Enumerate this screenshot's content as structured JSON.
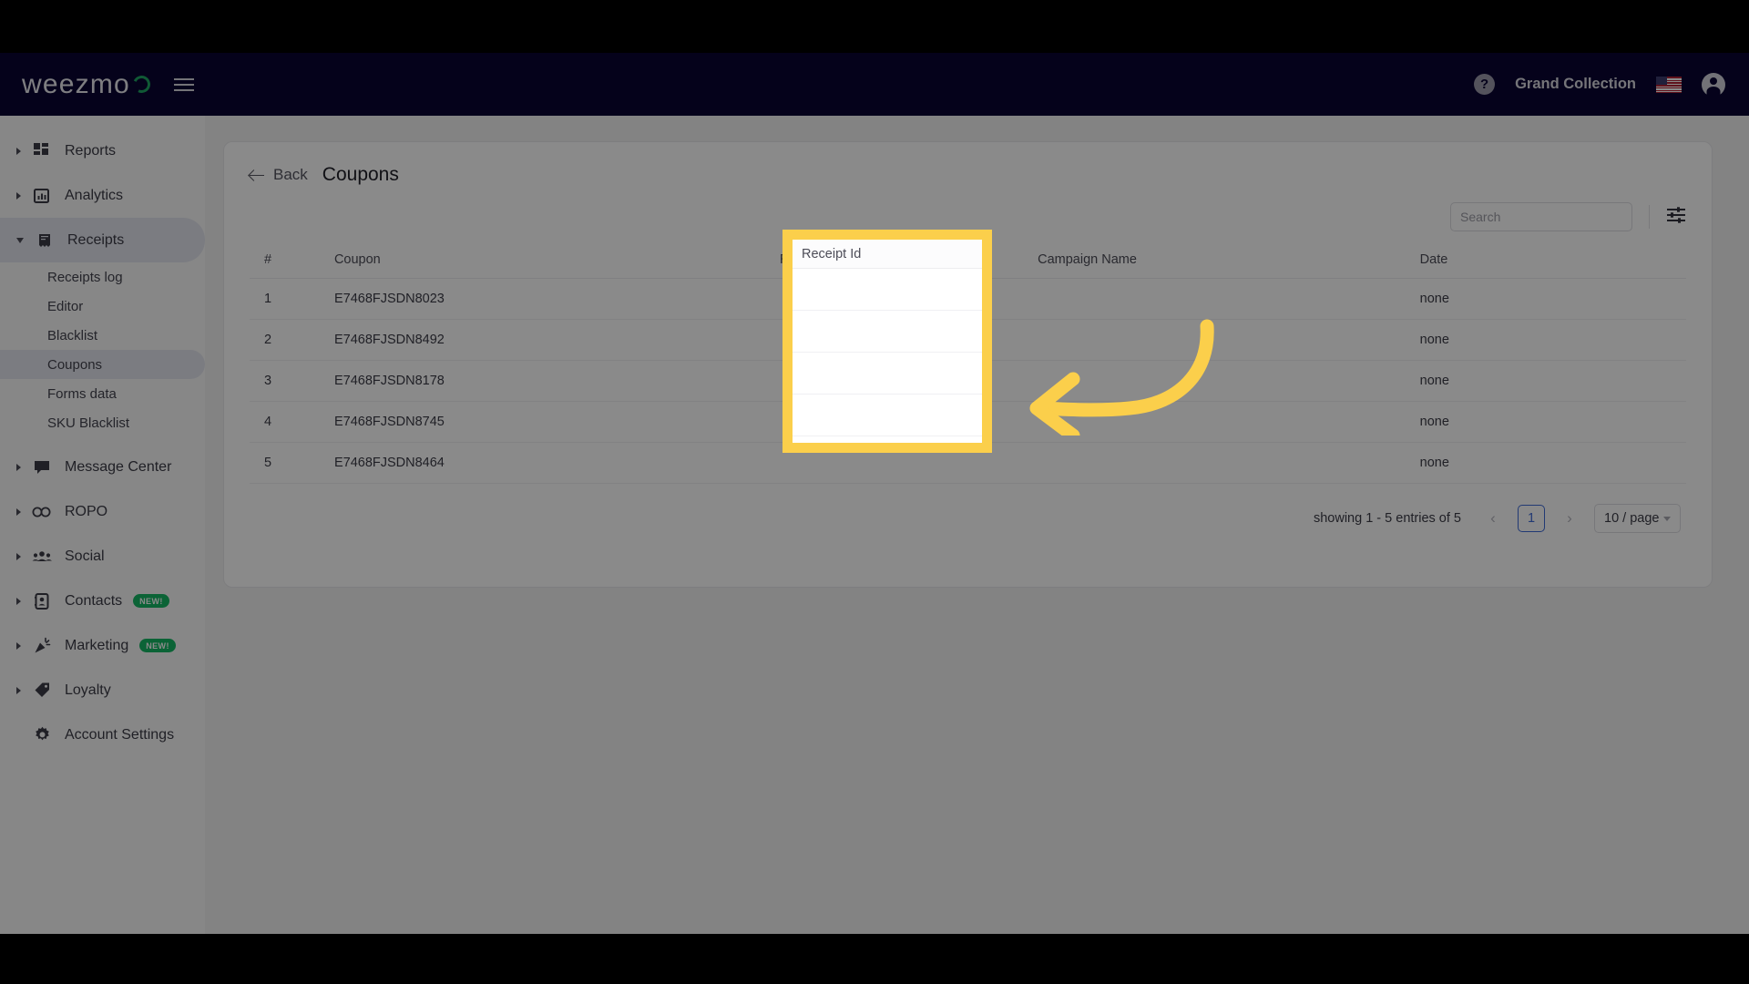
{
  "header": {
    "logo_text": "weezmo",
    "menu_icon": "hamburger-icon",
    "help_icon": "help-icon",
    "help_label": "?",
    "account_name": "Grand Collection",
    "language_flag": "us-flag",
    "avatar_icon": "account-avatar-icon"
  },
  "sidebar": {
    "items": [
      {
        "label": "Reports",
        "icon": "reports-icon",
        "expandable": true,
        "expanded": false,
        "active": false
      },
      {
        "label": "Analytics",
        "icon": "analytics-icon",
        "expandable": true,
        "expanded": false,
        "active": false
      },
      {
        "label": "Receipts",
        "icon": "receipts-icon",
        "expandable": true,
        "expanded": true,
        "active": true
      }
    ],
    "receipts_subitems": [
      {
        "label": "Receipts log",
        "active": false
      },
      {
        "label": "Editor",
        "active": false
      },
      {
        "label": "Blacklist",
        "active": false
      },
      {
        "label": "Coupons",
        "active": true
      },
      {
        "label": "Forms data",
        "active": false
      },
      {
        "label": "SKU Blacklist",
        "active": false
      }
    ],
    "items_lower": [
      {
        "label": "Message Center",
        "icon": "message-icon",
        "badge": "",
        "expandable": true
      },
      {
        "label": "ROPO",
        "icon": "ropo-icon",
        "badge": "",
        "expandable": true
      },
      {
        "label": "Social",
        "icon": "social-icon",
        "badge": "",
        "expandable": true
      },
      {
        "label": "Contacts",
        "icon": "contacts-icon",
        "badge": "NEW!",
        "expandable": true
      },
      {
        "label": "Marketing",
        "icon": "marketing-icon",
        "badge": "NEW!",
        "expandable": true
      },
      {
        "label": "Loyalty",
        "icon": "loyalty-icon",
        "badge": "",
        "expandable": true
      }
    ],
    "account_settings": {
      "label": "Account Settings",
      "icon": "gear-icon"
    }
  },
  "main": {
    "back_label": "Back",
    "page_title": "Coupons",
    "search": {
      "placeholder": "Search",
      "value": "",
      "icon": "search-icon"
    },
    "filter_icon": "filter-sliders-icon",
    "table": {
      "columns": [
        "#",
        "Coupon",
        "Receipt Id",
        "Campaign Name",
        "Date"
      ],
      "rows": [
        {
          "num": "1",
          "coupon": "E7468FJSDN8023",
          "receipt_id": "",
          "campaign_name": "",
          "date": "none"
        },
        {
          "num": "2",
          "coupon": "E7468FJSDN8492",
          "receipt_id": "",
          "campaign_name": "",
          "date": "none"
        },
        {
          "num": "3",
          "coupon": "E7468FJSDN8178",
          "receipt_id": "",
          "campaign_name": "",
          "date": "none"
        },
        {
          "num": "4",
          "coupon": "E7468FJSDN8745",
          "receipt_id": "",
          "campaign_name": "",
          "date": "none"
        },
        {
          "num": "5",
          "coupon": "E7468FJSDN8464",
          "receipt_id": "",
          "campaign_name": "",
          "date": "none"
        }
      ]
    },
    "pagination": {
      "showing_text": "showing 1 - 5 entries of 5",
      "prev_icon": "chevron-left-icon",
      "next_icon": "chevron-right-icon",
      "current_page": "1",
      "per_page": "10 / page"
    }
  },
  "annotation": {
    "highlight_column": "Receipt Id",
    "highlight_color": "#fbcf4b",
    "arrow_icon": "curved-arrow-left-icon",
    "arrow_color": "#fbcf4b"
  },
  "colors": {
    "topbar": "#0b0533",
    "accent_green": "#15b765",
    "page_bg": "#f2f2f2",
    "link_blue": "#3d6ad6"
  }
}
